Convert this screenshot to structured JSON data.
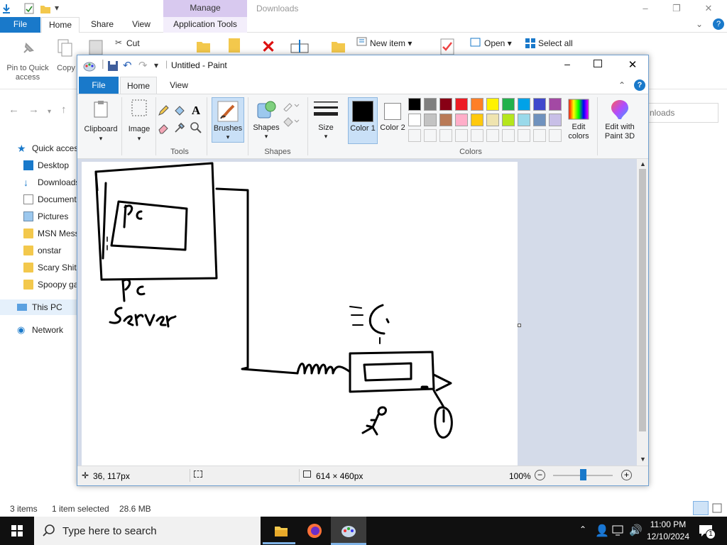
{
  "explorer": {
    "contextual_band": "Manage",
    "window_title": "Downloads",
    "tabs": [
      "File",
      "Home",
      "Share",
      "View",
      "Application Tools"
    ],
    "ribbon": {
      "pin_label": "Pin to Quick access",
      "copy_label": "Copy",
      "cut_label": "Cut",
      "new_item_label": "New item",
      "open_label": "Open",
      "select_all_label": "Select all"
    },
    "search_placeholder": "nloads",
    "sidebar": [
      {
        "label": "Quick access",
        "icon": "star-icon"
      },
      {
        "label": "Desktop",
        "icon": "desktop-icon"
      },
      {
        "label": "Downloads",
        "icon": "download-icon"
      },
      {
        "label": "Documents",
        "icon": "document-icon"
      },
      {
        "label": "Pictures",
        "icon": "pictures-icon"
      },
      {
        "label": "MSN Messenger",
        "icon": "folder-icon"
      },
      {
        "label": "onstar",
        "icon": "folder-icon"
      },
      {
        "label": "Scary Shit",
        "icon": "folder-icon"
      },
      {
        "label": "Spoopy games",
        "icon": "folder-icon"
      },
      {
        "label": "This PC",
        "icon": "pc-icon"
      },
      {
        "label": "Network",
        "icon": "network-icon"
      }
    ],
    "status": {
      "items": "3 items",
      "selected": "1 item selected",
      "size": "28.6 MB"
    }
  },
  "paint": {
    "title": "Untitled - Paint",
    "tabs": [
      "File",
      "Home",
      "View"
    ],
    "groups": {
      "clipboard": "Clipboard",
      "image": "Image",
      "tools": "Tools",
      "brushes": "Brushes",
      "shapes_btn": "Shapes",
      "shapes_group": "Shapes",
      "size": "Size",
      "color1": "Color 1",
      "color2": "Color 2",
      "colors_group": "Colors",
      "edit_colors": "Edit colors",
      "edit_paint3d": "Edit with Paint 3D"
    },
    "palette_row1": [
      "#000000",
      "#7f7f7f",
      "#880015",
      "#ed1c24",
      "#ff7f27",
      "#fff200",
      "#22b14c",
      "#00a2e8",
      "#3f48cc",
      "#a349a4"
    ],
    "palette_row2": [
      "#ffffff",
      "#c3c3c3",
      "#b97a57",
      "#ffaec9",
      "#ffc90e",
      "#efe4b0",
      "#b5e61d",
      "#99d9ea",
      "#7092be",
      "#c8bfe7"
    ],
    "canvas_text": {
      "pc_inner": "PC",
      "server_line1": "PC",
      "server_line2": "Server"
    },
    "status": {
      "cursor": "36, 117px",
      "size": "614 × 460px",
      "zoom": "100%"
    }
  },
  "taskbar": {
    "search_placeholder": "Type here to search",
    "time": "11:00 PM",
    "date": "12/10/2024",
    "notification_count": "1"
  },
  "colors": {
    "accent": "#1979ca",
    "manage_band": "#d8c9ef"
  }
}
